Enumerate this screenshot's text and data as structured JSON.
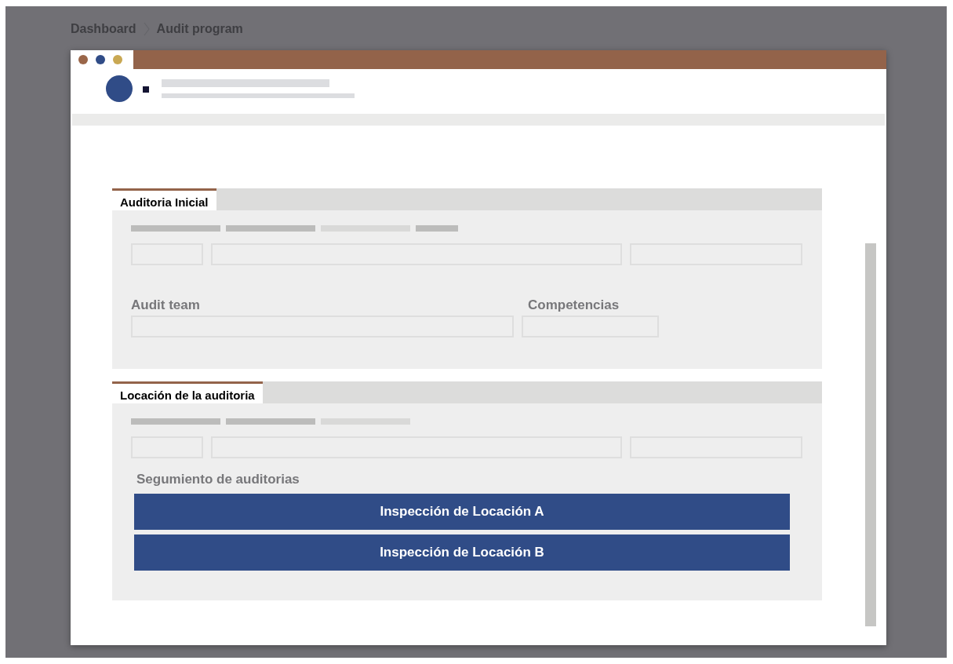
{
  "breadcrumb": [
    {
      "label": "Dashboard"
    },
    {
      "label": "Audit program"
    }
  ],
  "window": {
    "dots": [
      {
        "color": "#9a6649"
      },
      {
        "color": "#304c87"
      },
      {
        "color": "#c9a853"
      }
    ]
  },
  "sections": [
    {
      "title": "Auditoria Inicial",
      "field_labels": [
        "Audit team",
        "Competencias"
      ]
    },
    {
      "title": "Locación de la auditoria",
      "field_labels": [
        "Segumiento de auditorias"
      ],
      "buttons": [
        "Inspección de Locación A",
        "Inspección de Locación B"
      ]
    }
  ]
}
